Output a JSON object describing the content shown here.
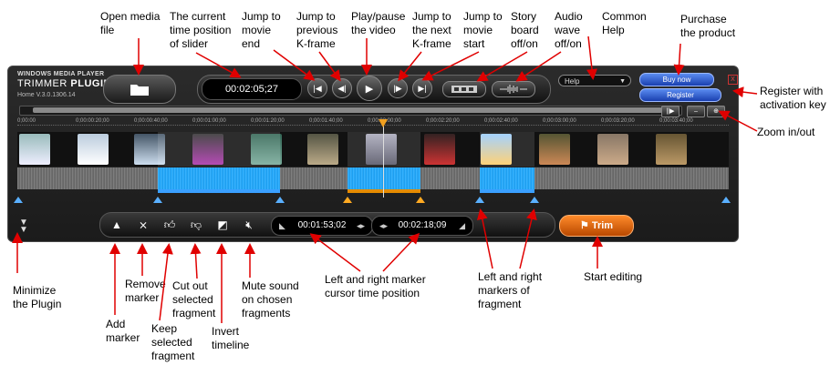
{
  "annotations": {
    "open_media": "Open media\nfile",
    "current_position": "The current\ntime position\nof slider",
    "jump_end": "Jump to\nmovie\nend",
    "jump_prev": "Jump to\nprevious\nK-frame",
    "play_pause": "Play/pause\nthe video",
    "jump_next": "Jump to\nthe next\nK-frame",
    "jump_start": "Jump to\nmovie\nstart",
    "story_board": "Story\nboard\noff/on",
    "audio_wave": "Audio\nwave\noff/on",
    "common_help": "Common\nHelp",
    "purchase": "Purchase\nthe product",
    "register": "Register with\nactivation key",
    "zoom": "Zoom in/out",
    "minimize": "Minimize\nthe Plugin",
    "add_marker": "Add\nmarker",
    "remove_marker": "Remove\nmarker",
    "keep_fragment": "Keep\nselected\nfragment",
    "cut_fragment": "Cut out\nselected\nfragment",
    "invert_timeline": "Invert\ntimeline",
    "mute_sound": "Mute sound\non chosen\nfragments",
    "marker_positions": "Left and right marker\ncursor time position",
    "fragment_markers": "Left and right\nmarkers of\nfragment",
    "start_editing": "Start editing"
  },
  "plugin": {
    "brand_line1": "WINDOWS MEDIA PLAYER",
    "brand_line2a": "TRIMMER ",
    "brand_line2b": "PLUGIN",
    "version": "Home V.3.0.1306.14",
    "current_time": "00:02:05;27",
    "help_label": "Help",
    "buy_label": "Buy now",
    "register_label": "Register",
    "close_label": "X",
    "left_marker_time": "00:01:53;02",
    "right_marker_time": "00:02:18;09",
    "trim_label": "Trim",
    "timeline_ticks": [
      "0;00:00",
      "0;00:00:20;00",
      "0;00:00:40;00",
      "0;00:01:00;00",
      "0;00:01:20;00",
      "0;00:01:40;00",
      "0;00:02:00;00",
      "0;00:02:20;00",
      "0;00:02:40;00",
      "0;00:03:00;00",
      "0;00:03:20;00",
      "0;00:03:40;00"
    ]
  },
  "icons": {
    "open": "folder-icon",
    "jump_start": "skip-start-icon",
    "prev": "prev-keyframe-icon",
    "play": "play-icon",
    "next": "next-keyframe-icon",
    "jump_end": "skip-end-icon",
    "storyboard": "filmstrip-icon",
    "waveform": "waveform-icon",
    "add_marker": "triangle-up-icon",
    "remove_marker": "remove-marker-icon",
    "keep": "thumbs-up-icon",
    "cut": "thumbs-down-icon",
    "invert": "invert-icon",
    "mute": "mute-icon",
    "trim": "flag-icon"
  },
  "colors": {
    "accent_blue": "#1ea7ff",
    "accent_orange": "#e58b00",
    "purchase_blue": "#2b5fd8"
  }
}
